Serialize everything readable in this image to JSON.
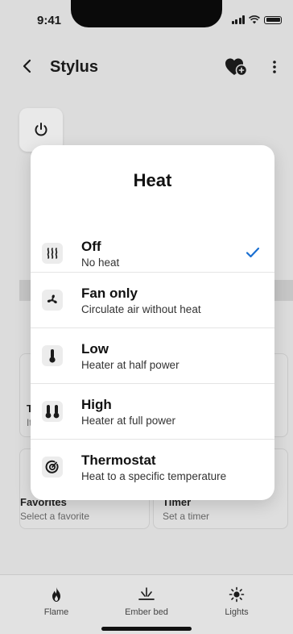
{
  "status": {
    "time": "9:41"
  },
  "nav": {
    "title": "Stylus"
  },
  "background_tiles": {
    "left_partial_title": "T",
    "left_partial_sub": "It",
    "favorites_title": "Favorites",
    "favorites_sub": "Select a favorite",
    "timer_title": "Timer",
    "timer_sub": "Set a timer"
  },
  "modal": {
    "title": "Heat",
    "options": [
      {
        "title": "Off",
        "subtitle": "No heat",
        "icon": "heat-waves-icon",
        "selected": true
      },
      {
        "title": "Fan only",
        "subtitle": "Circulate air without heat",
        "icon": "fan-icon",
        "selected": false
      },
      {
        "title": "Low",
        "subtitle": "Heater at half power",
        "icon": "thermometer-low-icon",
        "selected": false
      },
      {
        "title": "High",
        "subtitle": "Heater at full power",
        "icon": "thermometer-high-icon",
        "selected": false
      },
      {
        "title": "Thermostat",
        "subtitle": "Heat to a specific temperature",
        "icon": "thermostat-icon",
        "selected": false
      }
    ]
  },
  "tabs": [
    {
      "label": "Flame",
      "icon": "flame-icon"
    },
    {
      "label": "Ember bed",
      "icon": "ember-bed-icon"
    },
    {
      "label": "Lights",
      "icon": "sun-icon"
    }
  ],
  "colors": {
    "accent": "#1a6fd1",
    "text": "#111111",
    "dim_background": "#dcdcdc"
  }
}
